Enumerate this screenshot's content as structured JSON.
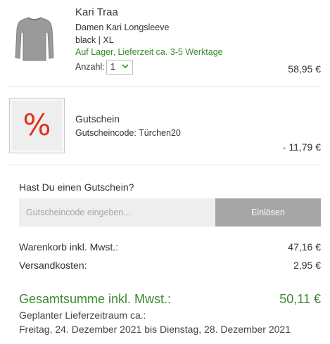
{
  "colors": {
    "accent_green": "#3b8a2f",
    "voucher_red": "#e0301e",
    "button_gray": "#a6a6a6",
    "input_gray": "#eeeeee"
  },
  "product": {
    "brand": "Kari Traa",
    "name": "Damen Kari Longsleeve",
    "variant": "black | XL",
    "availability": "Auf Lager, Lieferzeit ca. 3-5 Werktage",
    "quantity_label": "Anzahl:",
    "quantity_value": "1",
    "price": "58,95 €",
    "image_icon": "longsleeve-shirt-image"
  },
  "voucher": {
    "icon": "percent-voucher-icon",
    "symbol": "%",
    "title": "Gutschein",
    "code": "Gutscheincode: Türchen20",
    "amount": "- 11,79 €"
  },
  "coupon_form": {
    "question": "Hast Du einen Gutschein?",
    "placeholder": "Gutscheincode eingeben...",
    "button_label": "Einlösen"
  },
  "summary": {
    "cart_label": "Warenkorb inkl. Mwst.:",
    "cart_value": "47,16 €",
    "shipping_label": "Versandkosten:",
    "shipping_value": "2,95 €",
    "total_label": "Gesamtsumme inkl. Mwst.:",
    "total_value": "50,11 €",
    "delivery_label": "Geplanter Lieferzeitraum ca.:",
    "delivery_range": "Freitag, 24. Dezember 2021 bis Dienstag, 28. Dezember 2021"
  }
}
